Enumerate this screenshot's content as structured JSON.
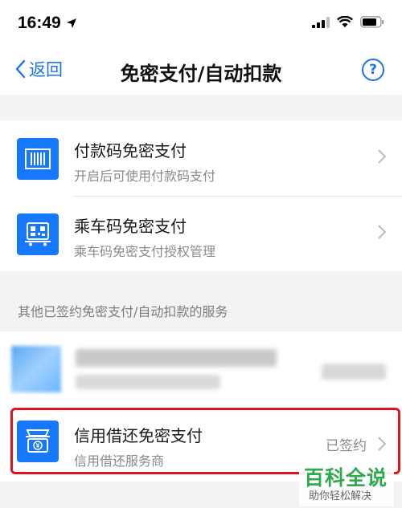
{
  "status_bar": {
    "time": "16:49"
  },
  "nav": {
    "back_label": "返回",
    "title": "免密支付/自动扣款",
    "help_symbol": "?"
  },
  "items": [
    {
      "title": "付款码免密支付",
      "subtitle": "开启后可使用付款码支付"
    },
    {
      "title": "乘车码免密支付",
      "subtitle": "乘车码免密支付授权管理"
    }
  ],
  "section_label": "其他已签约免密支付/自动扣款的服务",
  "credit_item": {
    "title": "信用借还免密支付",
    "subtitle": "信用借还服务商",
    "status": "已签约"
  },
  "watermark": {
    "main": "百科全说",
    "sub": "助你轻松解决"
  },
  "colors": {
    "accent": "#1a73e8",
    "icon_bg": "#1677ff",
    "highlight": "#e0141e",
    "watermark": "#2fa84f"
  },
  "icons": [
    "location-arrow-icon",
    "signal-icon",
    "wifi-icon",
    "battery-icon",
    "back-chevron-icon",
    "help-icon",
    "barcode-icon",
    "transit-qr-icon",
    "chevron-right-icon",
    "credit-borrow-icon"
  ]
}
